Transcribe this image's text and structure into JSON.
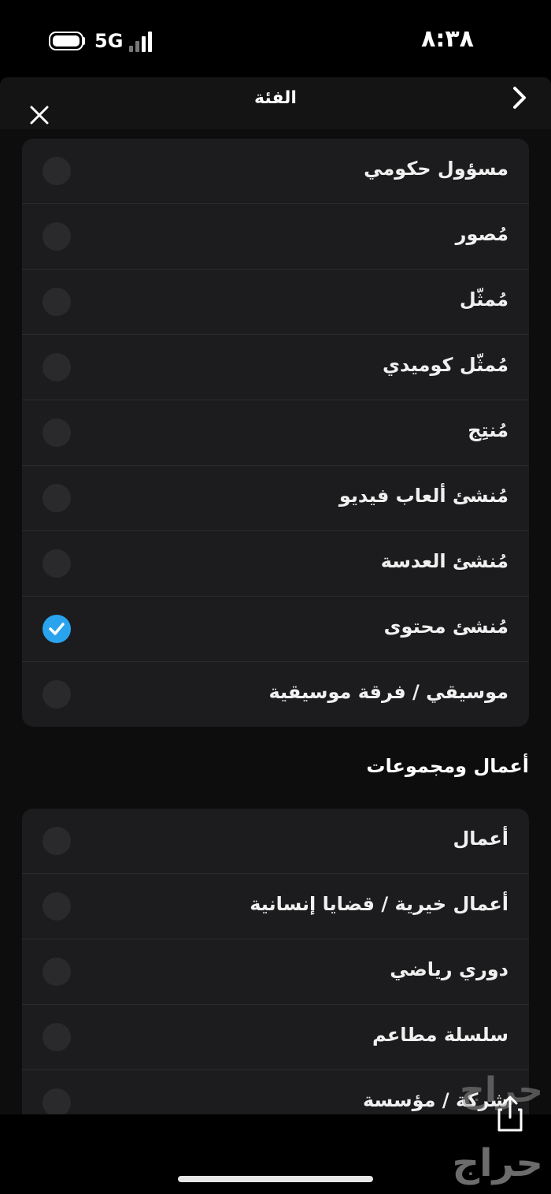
{
  "status_bar": {
    "time": "٨:٣٨",
    "network": "5G"
  },
  "header": {
    "title": "الفئة"
  },
  "list_items": [
    {
      "label": "مسؤول حكومي",
      "checked": false
    },
    {
      "label": "مُصور",
      "checked": false
    },
    {
      "label": "مُمثّل",
      "checked": false
    },
    {
      "label": "مُمثّل كوميدي",
      "checked": false
    },
    {
      "label": "مُنتِج",
      "checked": false
    },
    {
      "label": "مُنشئ ألعاب فيديو",
      "checked": false
    },
    {
      "label": "مُنشئ العدسة",
      "checked": false
    },
    {
      "label": "مُنشئ محتوى",
      "checked": true
    },
    {
      "label": "موسيقي / فرقة موسيقية",
      "checked": false
    }
  ],
  "section2": {
    "title": "أعمال ومجموعات",
    "items": [
      {
        "label": "أعمال",
        "checked": false
      },
      {
        "label": "أعمال خيرية / قضايا إنسانية",
        "checked": false
      },
      {
        "label": "دوري رياضي",
        "checked": false
      },
      {
        "label": "سلسلة مطاعم",
        "checked": false
      },
      {
        "label": "شركة / مؤسسة",
        "checked": false
      }
    ]
  },
  "watermark": {
    "text": "حراج"
  },
  "colors": {
    "accent": "#2aa3ef",
    "card": "#1c1c1e",
    "background": "#0d0d0d"
  },
  "icons": {
    "close": "close-icon",
    "chevron": "chevron-right-icon",
    "check": "check-icon",
    "share": "share-icon"
  }
}
